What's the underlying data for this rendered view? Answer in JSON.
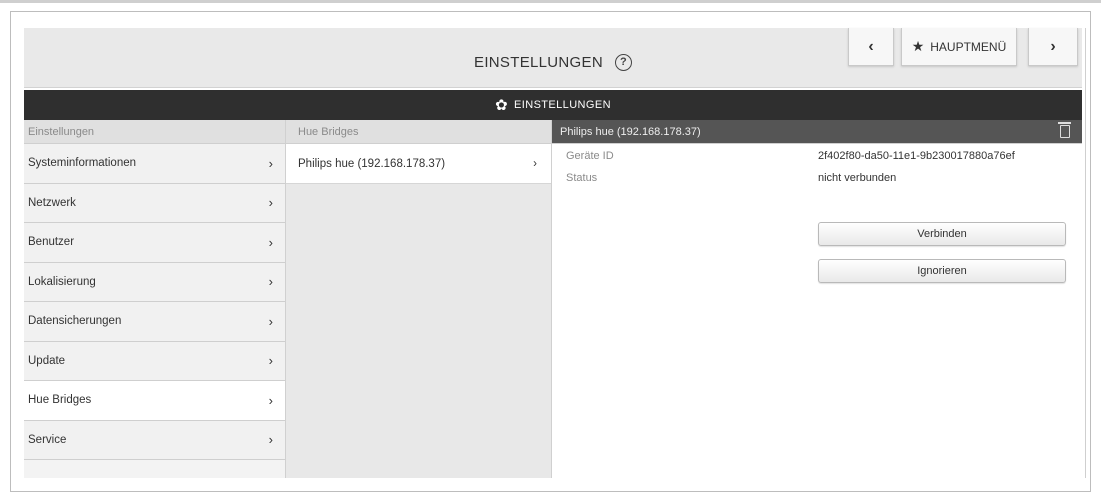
{
  "header": {
    "title": "EINSTELLUNGEN",
    "help_icon": "?",
    "prev_icon": "‹",
    "main_menu_label": "HAUPTMENÜ",
    "next_icon": "›"
  },
  "toolbar": {
    "label": "EINSTELLUNGEN"
  },
  "column1": {
    "header": "Einstellungen",
    "items": [
      {
        "label": "Systeminformationen"
      },
      {
        "label": "Netzwerk"
      },
      {
        "label": "Benutzer"
      },
      {
        "label": "Lokalisierung"
      },
      {
        "label": "Datensicherungen"
      },
      {
        "label": "Update"
      },
      {
        "label": "Hue Bridges"
      },
      {
        "label": "Service"
      }
    ],
    "active_item": "Hue Bridges"
  },
  "column2": {
    "header": "Hue Bridges",
    "items": [
      {
        "label": "Philips hue (192.168.178.37)"
      }
    ]
  },
  "column3": {
    "header": "Philips hue (192.168.178.37)",
    "fields": [
      {
        "label": "Geräte ID",
        "value": "2f402f80-da50-11e1-9b230017880a76ef"
      },
      {
        "label": "Status",
        "value": "nicht verbunden"
      }
    ],
    "connect_label": "Verbinden",
    "ignore_label": "Ignorieren"
  }
}
